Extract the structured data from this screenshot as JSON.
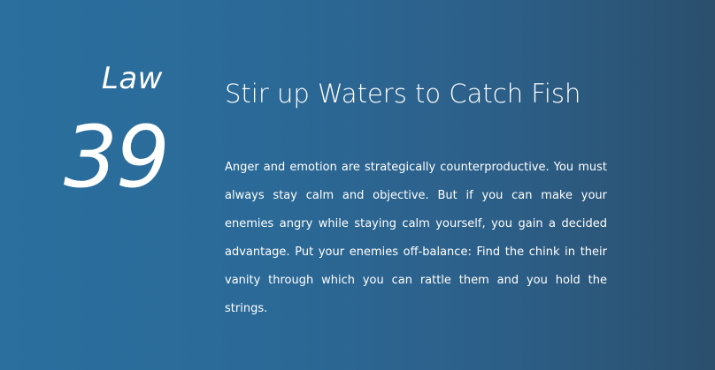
{
  "law": {
    "label": "Law",
    "number": "39"
  },
  "title": "Stir up Waters to Catch Fish",
  "body": "Anger and emotion are strategically counterproductive. You must always stay calm and objective. But if you can make your enemies angry while staying calm yourself, you gain a decided advantage. Put your enemies off-balance: Find the chink in their vanity through which you can rattle them and you hold the strings.",
  "colors": {
    "background_left": "#2a6f9e",
    "background_right": "#2b4f6d",
    "text": "#ffffff"
  }
}
